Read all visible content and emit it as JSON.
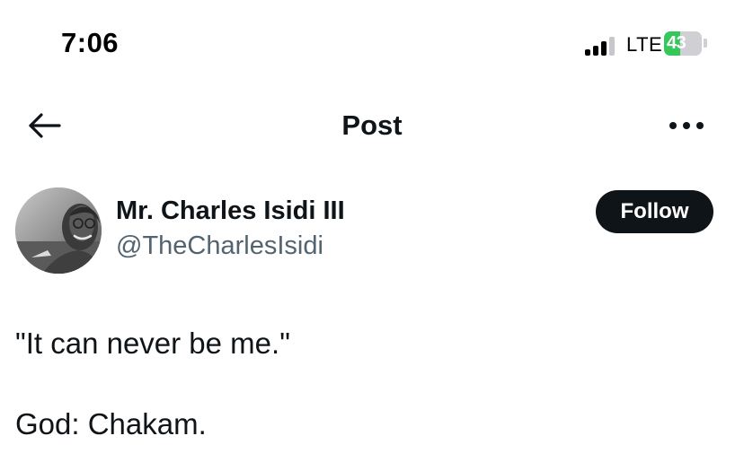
{
  "status_bar": {
    "time": "7:06",
    "network": "LTE",
    "battery_level": "43",
    "battery_fraction": 0.43,
    "signal_bars_active": 3,
    "signal_bars_total": 4,
    "battery_color": "#34c759"
  },
  "nav": {
    "title": "Post",
    "back_icon": "arrow-left-icon",
    "more_icon": "more-horizontal-icon"
  },
  "post": {
    "author": {
      "display_name": "Mr. Charles Isidi III",
      "handle": "@TheCharlesIsidi"
    },
    "follow_label": "Follow",
    "body_lines": [
      "\"It can never be me.\"",
      "",
      "God: Chakam."
    ]
  },
  "colors": {
    "text_primary": "#0f1419",
    "text_secondary": "#536471",
    "follow_bg": "#0f1419",
    "follow_text": "#ffffff"
  }
}
